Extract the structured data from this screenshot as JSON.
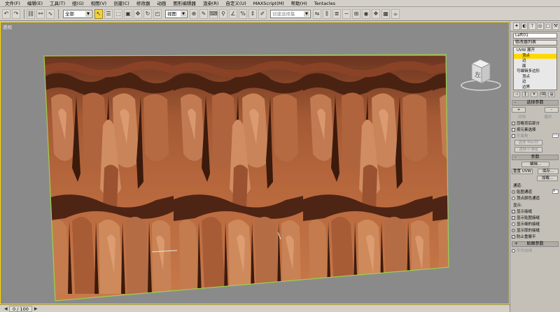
{
  "menu": [
    "文件(F)",
    "编辑(E)",
    "工具(T)",
    "组(G)",
    "视图(V)",
    "创建(C)",
    "修改器",
    "动画",
    "图形编辑器",
    "渲染(R)",
    "自定义(U)",
    "MAXScript(M)",
    "帮助(H)",
    "Tentacles"
  ],
  "toolbar": {
    "selection_filter": "全部",
    "reference_coord": "视图",
    "named_selection_placeholder": "创建选择集"
  },
  "viewport": {
    "label": "透视",
    "viewcube_label": "左"
  },
  "status": {
    "frame_counter": "0 / 100"
  },
  "panel": {
    "object_name": "Left01",
    "modifier_list": "修改器列表",
    "stack": [
      {
        "label": "UVW 展开",
        "level": 0,
        "selected": false
      },
      {
        "label": "顶点",
        "level": 1,
        "selected": true
      },
      {
        "label": "边",
        "level": 1,
        "selected": false
      },
      {
        "label": "面",
        "level": 1,
        "selected": false
      },
      {
        "label": "可编辑多边形",
        "level": 0,
        "selected": false
      },
      {
        "label": "顶点",
        "level": 1,
        "selected": false
      },
      {
        "label": "边",
        "level": 1,
        "selected": false
      },
      {
        "label": "边界",
        "level": 1,
        "selected": false
      }
    ],
    "selection_rollout": {
      "title": "选择参数",
      "plus": "+",
      "minus": "-",
      "ring": "环形",
      "loop": "循环",
      "ignore_backface": "忽略背后部分",
      "select_by_element": "按元素选择",
      "planar_angle": "平面角",
      "planar_value": "15.0",
      "select_matid": "选择 MatID",
      "select_smooth": "选择平滑组"
    },
    "params_rollout": {
      "title": "参数",
      "edit": "编辑...",
      "reset_uvw": "重置 UVW",
      "save": "保存...",
      "load": "加载...",
      "channel_label": "通道:",
      "map_channel": "贴图通道",
      "map_channel_value": "1",
      "vertex_color_channel": "顶点颜色通道",
      "display_label": "显示:",
      "show_seams": "显示接缝",
      "show_map_seams": "显示贴图接缝",
      "show_thin_seams": "显示细的接缝",
      "show_thick_seams": "显示厚的接缝",
      "prevent_reflatten": "防止重展平",
      "map_params": "贴图参数",
      "smooth_edge": "平均法线"
    }
  }
}
